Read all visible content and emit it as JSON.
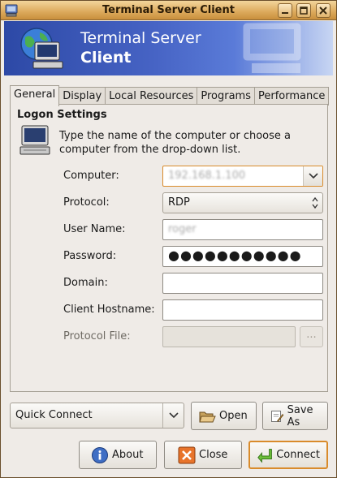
{
  "window": {
    "title": "Terminal Server Client"
  },
  "banner": {
    "title_line1": "Terminal Server",
    "title_line2": "Client"
  },
  "tabs": [
    {
      "label": "General",
      "active": true
    },
    {
      "label": "Display",
      "active": false
    },
    {
      "label": "Local Resources",
      "active": false
    },
    {
      "label": "Programs",
      "active": false
    },
    {
      "label": "Performance",
      "active": false
    }
  ],
  "logon": {
    "section_title": "Logon Settings",
    "description": "Type the name of the computer or choose a computer from the drop-down list.",
    "computer_label": "Computer:",
    "computer_value": "192.168.1.100",
    "protocol_label": "Protocol:",
    "protocol_value": "RDP",
    "username_label": "User Name:",
    "username_value": "roger",
    "password_label": "Password:",
    "password_value": "●●●●●●●●●●●",
    "domain_label": "Domain:",
    "domain_value": "",
    "hostname_label": "Client Hostname:",
    "hostname_value": "",
    "protocol_file_label": "Protocol File:",
    "protocol_file_value": "",
    "browse_label": "..."
  },
  "quick_connect": {
    "label": "Quick Connect"
  },
  "buttons": {
    "open": "Open",
    "save_as": "Save As",
    "about": "About",
    "close": "Close",
    "connect": "Connect"
  },
  "colors": {
    "titlebar": "#dca95b",
    "banner": "#4663c4",
    "focus_border": "#d98b2b"
  }
}
